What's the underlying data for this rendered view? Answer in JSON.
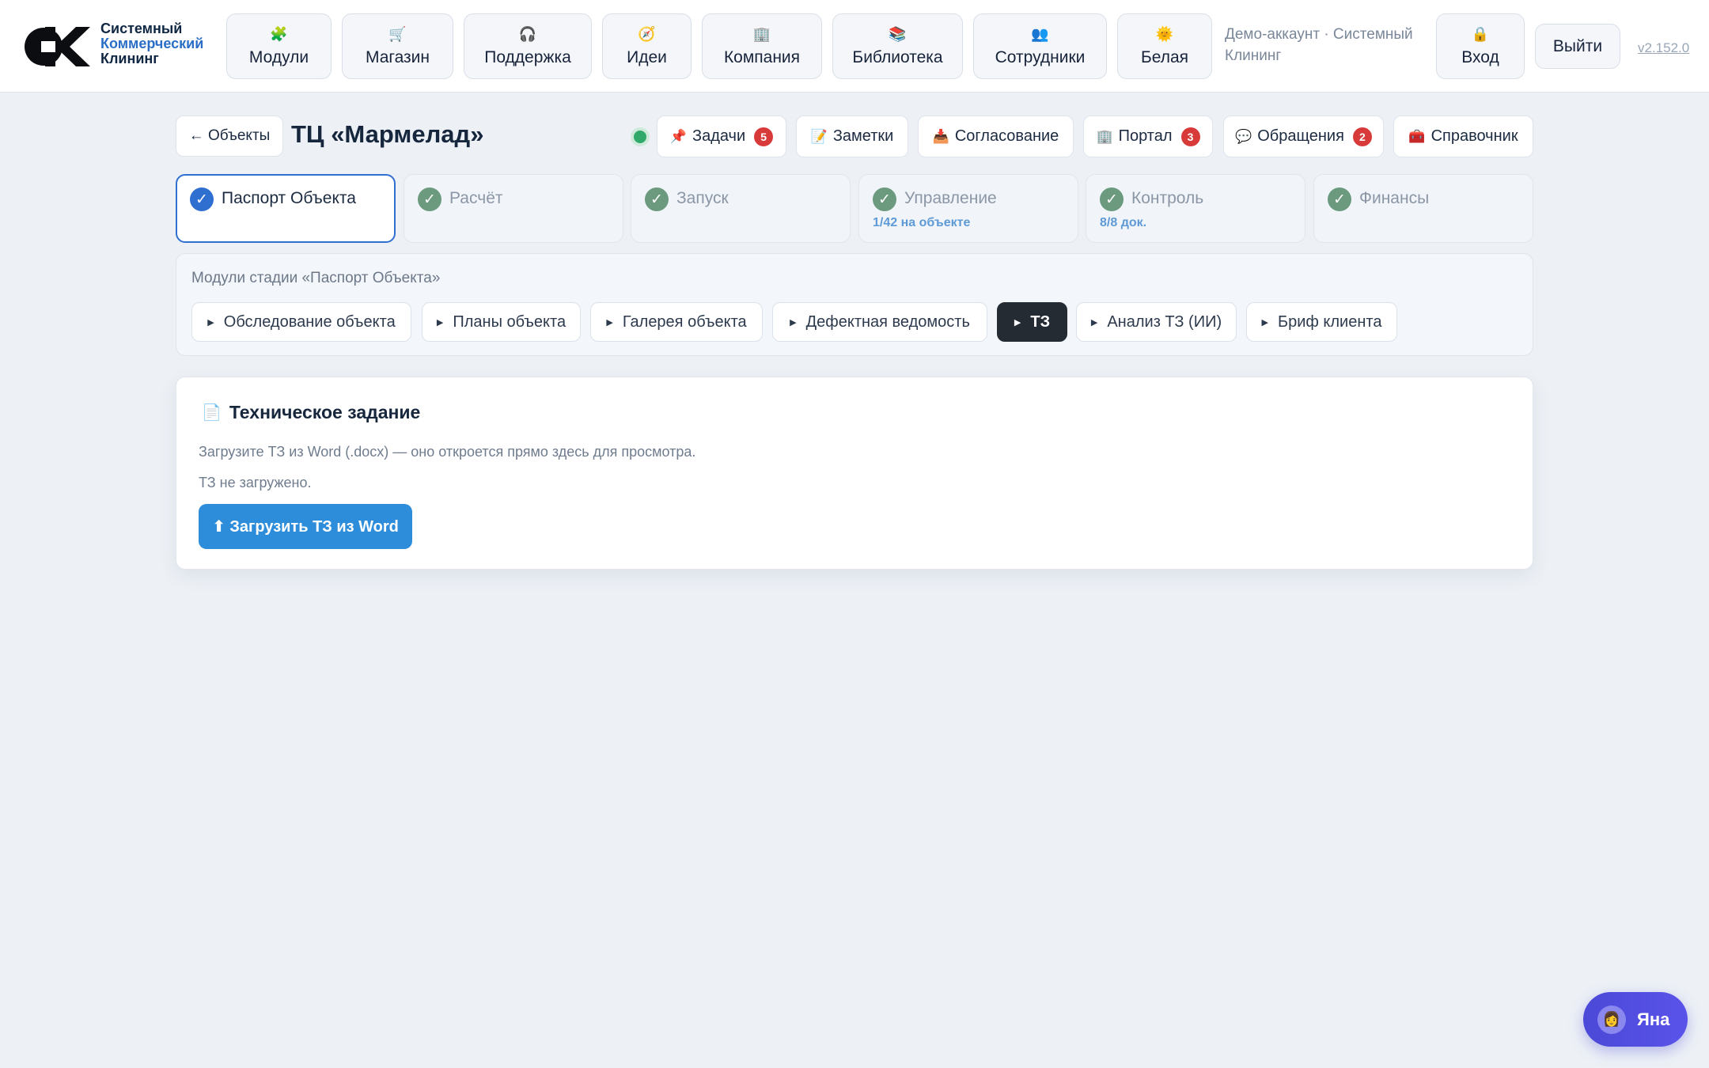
{
  "brand": {
    "line1": "Системный",
    "line2": "Коммерческий",
    "line3": "Клининг"
  },
  "nav": [
    {
      "label": "Модули",
      "icon": "🧩",
      "icon_name": "puzzle-icon"
    },
    {
      "label": "Магазин",
      "icon": "🛒",
      "icon_name": "cart-icon"
    },
    {
      "label": "Поддержка",
      "icon": "🎧",
      "icon_name": "headset-icon"
    },
    {
      "label": "Идеи",
      "icon": "🧭",
      "icon_name": "compass-icon"
    },
    {
      "label": "Компания",
      "icon": "🏢",
      "icon_name": "office-icon"
    },
    {
      "label": "Библиотека",
      "icon": "📚",
      "icon_name": "books-icon"
    },
    {
      "label": "Сотрудники",
      "icon": "👥",
      "icon_name": "people-icon"
    },
    {
      "label": "Белая",
      "icon": "🌞",
      "icon_name": "sun-icon"
    },
    {
      "label": "Вход",
      "icon": "🔒",
      "icon_name": "lock-icon"
    }
  ],
  "account": "Демо-аккаунт · Системный Клининг",
  "logout_label": "Выйти",
  "version": "v2.152.0",
  "header": {
    "back_label": "← Объекты",
    "title": "ТЦ «Мармелад»",
    "status_color": "#2fa86a"
  },
  "tools": [
    {
      "label": "Задачи",
      "icon": "📌",
      "icon_name": "pin-icon",
      "badge": "5"
    },
    {
      "label": "Заметки",
      "icon": "📝",
      "icon_name": "memo-icon",
      "badge": ""
    },
    {
      "label": "Согласование",
      "icon": "📥",
      "icon_name": "inbox-icon",
      "badge": ""
    },
    {
      "label": "Портал",
      "icon": "🏢",
      "icon_name": "building-icon",
      "badge": "3"
    },
    {
      "label": "Обращения",
      "icon": "💬",
      "icon_name": "speech-bubble-icon",
      "badge": "2"
    },
    {
      "label": "Справочник",
      "icon": "🧰",
      "icon_name": "toolbox-icon",
      "badge": ""
    }
  ],
  "stages": [
    {
      "label": "Паспорт Объекта",
      "sub": "",
      "active": true
    },
    {
      "label": "Расчёт",
      "sub": "",
      "active": false
    },
    {
      "label": "Запуск",
      "sub": "",
      "active": false
    },
    {
      "label": "Управление",
      "sub": "1/42 на объекте",
      "active": false
    },
    {
      "label": "Контроль",
      "sub": "8/8 док.",
      "active": false
    },
    {
      "label": "Финансы",
      "sub": "",
      "active": false
    }
  ],
  "modules": {
    "title": "Модули стадии «Паспорт Объекта»",
    "items": [
      {
        "label": "Обследование объекта",
        "active": false
      },
      {
        "label": "Планы объекта",
        "active": false
      },
      {
        "label": "Галерея объекта",
        "active": false
      },
      {
        "label": "Дефектная ведомость",
        "active": false
      },
      {
        "label": "ТЗ",
        "active": true
      },
      {
        "label": "Анализ ТЗ (ИИ)",
        "active": false
      },
      {
        "label": "Бриф клиента",
        "active": false
      }
    ]
  },
  "card": {
    "icon": "📄",
    "title": "Техническое задание",
    "description": "Загрузите ТЗ из Word (.docx) — оно откроется прямо здесь для просмотра.",
    "status": "ТЗ не загружено.",
    "upload_label": "⬆ Загрузить ТЗ из Word"
  },
  "assistant": {
    "name": "Яна",
    "avatar": "👩"
  },
  "colors": {
    "accent": "#2f6fd0",
    "upload": "#2e8ddb",
    "badge": "#d83a3a",
    "assistant": "#4b49d7"
  }
}
